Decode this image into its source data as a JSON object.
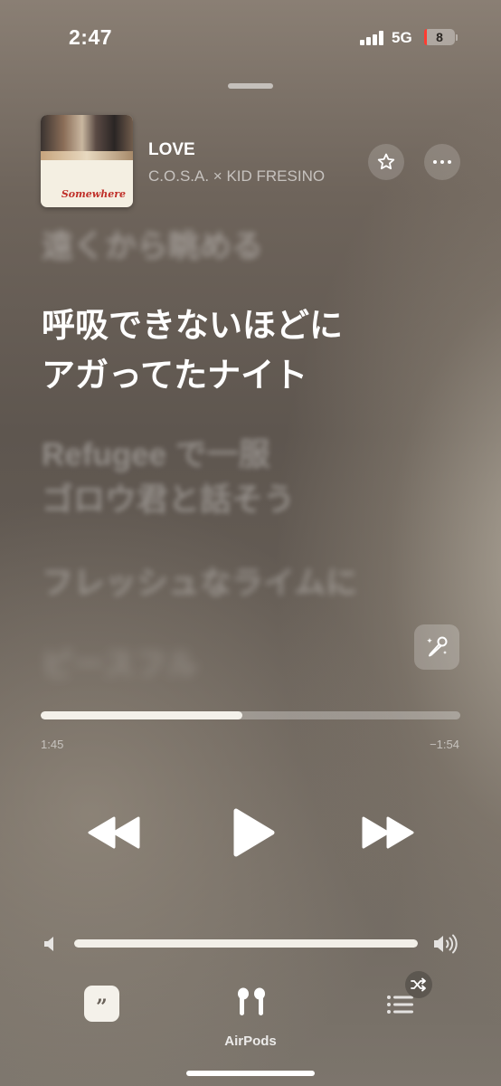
{
  "status_bar": {
    "time": "2:47",
    "network": "5G",
    "battery": "8",
    "battery_level": 0.08
  },
  "now_playing": {
    "title": "LOVE",
    "artist": "C.O.S.A. × KID FRESINO",
    "album_art_text": "Somewhere"
  },
  "lyrics": {
    "previous": "遠くから眺める",
    "current": [
      "呼吸できないほどに",
      "アガってたナイト"
    ],
    "next": [
      "Refugee で一服",
      "ゴロウ君と話そう"
    ],
    "following": "フレッシュなライムに",
    "faded": "ピースフル"
  },
  "progress": {
    "elapsed": "1:45",
    "remaining": "−1:54",
    "fraction": 0.48
  },
  "volume": {
    "fraction": 1.0
  },
  "bottom_bar": {
    "airpods_label": "AirPods"
  },
  "icons": {
    "favorite": "star-icon",
    "more": "ellipsis-icon",
    "sing": "microphone-sparkle-icon",
    "rewind": "rewind-icon",
    "play": "play-icon",
    "forward": "fast-forward-icon",
    "volume_low": "speaker-low-icon",
    "volume_high": "speaker-high-icon",
    "lyrics": "quote-bubble-icon",
    "airpods": "airpods-icon",
    "queue": "list-icon",
    "shuffle": "shuffle-icon"
  },
  "colors": {
    "battery_low": "#ff3b30",
    "accent_fill": "#f4f1ea"
  }
}
